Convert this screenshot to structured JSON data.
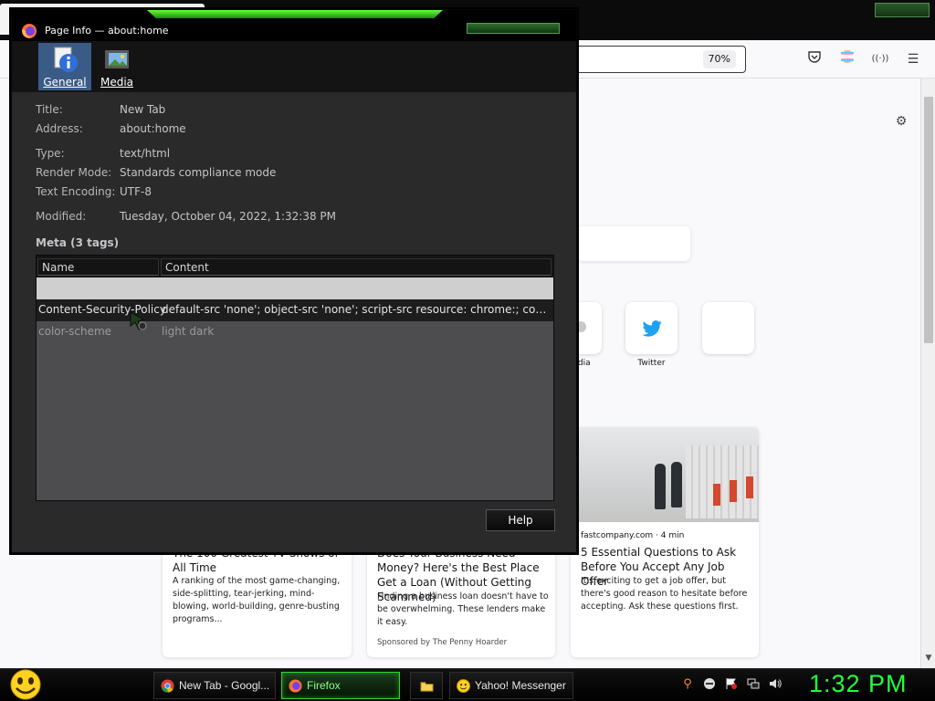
{
  "browser": {
    "zoom": "70%",
    "top_sites": [
      {
        "label": "edia"
      },
      {
        "label": "Twitter"
      },
      {
        "label": ""
      }
    ],
    "stories": [
      {
        "source": "",
        "headline": "The 100 Greatest TV Shows of All Time",
        "excerpt": "A ranking of the most game-changing, side-splitting, tear-jerking, mind-blowing, world-building, genre-busting programs...",
        "sponsor": ""
      },
      {
        "source": "",
        "headline": "Does Your Business Need Money? Here's the Best Place Get a Loan (Without Getting Scammed)",
        "excerpt": "Finding a business loan doesn't have to be overwhelming. These lenders make it easy.",
        "sponsor": "Sponsored by The Penny Hoarder"
      },
      {
        "source": "fastcompany.com · 4 min",
        "headline": "5 Essential Questions to Ask Before You Accept Any Job Offer",
        "excerpt": "It's exciting to get a job offer, but there's good reason to hesitate before accepting. Ask these questions first.",
        "sponsor": ""
      }
    ]
  },
  "dialog": {
    "title": "Page Info — about:home",
    "tabs": [
      {
        "label": "General",
        "selected": true
      },
      {
        "label": "Media",
        "selected": false
      }
    ],
    "fields": {
      "title_label": "Title:",
      "title_value": "New Tab",
      "address_label": "Address:",
      "address_value": "about:home",
      "type_label": "Type:",
      "type_value": "text/html",
      "render_label": "Render Mode:",
      "render_value": "Standards compliance mode",
      "encoding_label": "Text Encoding:",
      "encoding_value": "UTF-8",
      "modified_label": "Modified:",
      "modified_value": "Tuesday, October 04, 2022, 1:32:38 PM"
    },
    "meta_heading": "Meta (3 tags)",
    "meta_columns": [
      "Name",
      "Content"
    ],
    "meta_rows": [
      {
        "name": "Content-Security-Policy",
        "content": "default-src 'none'; object-src 'none'; script-src resource: chrome:; connect-src ..."
      },
      {
        "name": "color-scheme",
        "content": "light dark"
      }
    ],
    "help_label": "Help"
  },
  "taskbar": {
    "tasks": [
      {
        "label": "New Tab - Googl..."
      },
      {
        "label": "Firefox",
        "active": true
      },
      {
        "label": ""
      },
      {
        "label": "Yahoo! Messenger"
      }
    ],
    "clock": "1:32 PM"
  },
  "colors": {
    "clock_green": "#20ff3c",
    "active_task_green": "#2fd52f",
    "dialog_bg": "#2a2a2b",
    "selected_tab": "#3b5b87"
  },
  "icons": {
    "dialog": "firefox-icon",
    "general_tab": "info-icon",
    "media_tab": "image-icon",
    "toolbar": [
      "pocket-icon",
      "account-icon",
      "extensions-icon",
      "menu-icon"
    ],
    "tray": [
      "search-icon",
      "status-icon",
      "flag-icon",
      "network-icon",
      "volume-icon"
    ]
  }
}
